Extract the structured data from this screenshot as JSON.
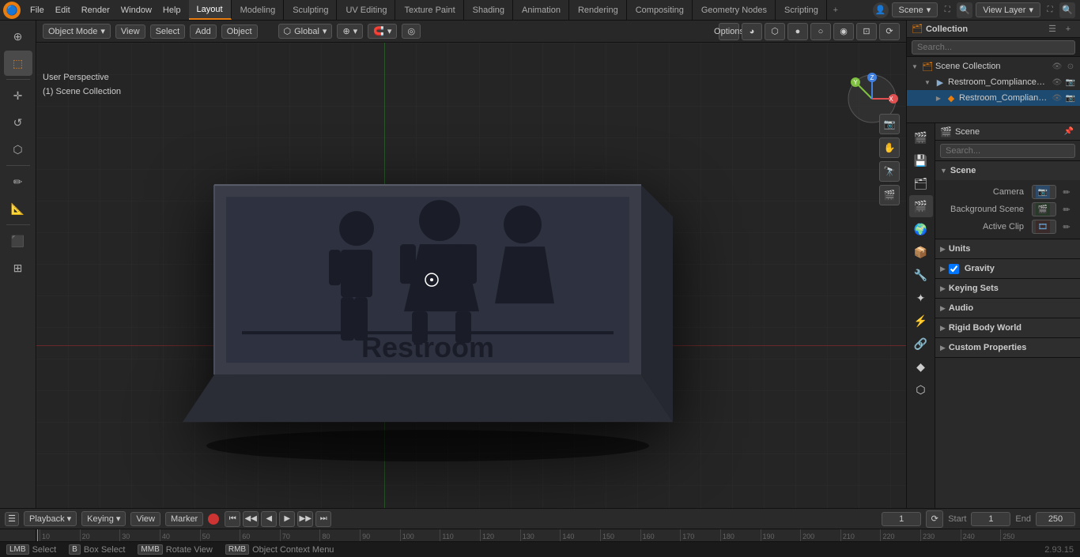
{
  "topMenu": {
    "menuItems": [
      "File",
      "Edit",
      "Render",
      "Window",
      "Help"
    ],
    "workspaceTabs": [
      {
        "label": "Layout",
        "active": true
      },
      {
        "label": "Modeling",
        "active": false
      },
      {
        "label": "Sculpting",
        "active": false
      },
      {
        "label": "UV Editing",
        "active": false
      },
      {
        "label": "Texture Paint",
        "active": false
      },
      {
        "label": "Shading",
        "active": false
      },
      {
        "label": "Animation",
        "active": false
      },
      {
        "label": "Rendering",
        "active": false
      },
      {
        "label": "Compositing",
        "active": false
      },
      {
        "label": "Geometry Nodes",
        "active": false
      },
      {
        "label": "Scripting",
        "active": false
      }
    ],
    "engineLabel": "Scene",
    "viewLayerLabel": "View Layer"
  },
  "viewport": {
    "viewTitle": "User Perspective",
    "sceneTitle": "(1) Scene Collection",
    "transform": "Global",
    "optionsLabel": "Options"
  },
  "outliner": {
    "title": "Collection",
    "items": [
      {
        "label": "Scene Collection",
        "indent": 0,
        "expanded": true,
        "icon": "🗂"
      },
      {
        "label": "Restroom_Compliance_Sign_",
        "indent": 1,
        "expanded": true,
        "icon": "▶"
      },
      {
        "label": "Restroom_Compliance_S",
        "indent": 2,
        "expanded": false,
        "icon": "◆"
      }
    ]
  },
  "properties": {
    "title": "Scene",
    "subtitle": "Scene",
    "sections": [
      {
        "label": "Scene",
        "expanded": true,
        "fields": [
          {
            "label": "Camera",
            "value": "",
            "hasIcon": true
          },
          {
            "label": "Background Scene",
            "value": "",
            "hasIcon": true
          },
          {
            "label": "Active Clip",
            "value": "",
            "hasIcon": true
          }
        ]
      },
      {
        "label": "Units",
        "expanded": false
      },
      {
        "label": "Gravity",
        "expanded": false,
        "hasCheckbox": true
      },
      {
        "label": "Keying Sets",
        "expanded": false
      },
      {
        "label": "Audio",
        "expanded": false
      },
      {
        "label": "Rigid Body World",
        "expanded": false
      },
      {
        "label": "Custom Properties",
        "expanded": false
      }
    ]
  },
  "timeline": {
    "playbackLabel": "Playback",
    "keyingLabel": "Keying",
    "viewLabel": "View",
    "markerLabel": "Marker",
    "currentFrame": "1",
    "startFrame": "1",
    "endFrame": "250",
    "startLabel": "Start",
    "endLabel": "End"
  },
  "ruler": {
    "marks": [
      "10",
      "20",
      "30",
      "40",
      "50",
      "60",
      "70",
      "80",
      "90",
      "100",
      "110",
      "120",
      "130",
      "140",
      "150",
      "160",
      "170",
      "180",
      "190",
      "200",
      "210",
      "220",
      "230",
      "240",
      "250"
    ]
  },
  "statusBar": {
    "selectLabel": "Select",
    "boxSelectLabel": "Box Select",
    "rotateLabel": "Rotate View",
    "contextLabel": "Object Context Menu",
    "version": "2.93.15"
  }
}
